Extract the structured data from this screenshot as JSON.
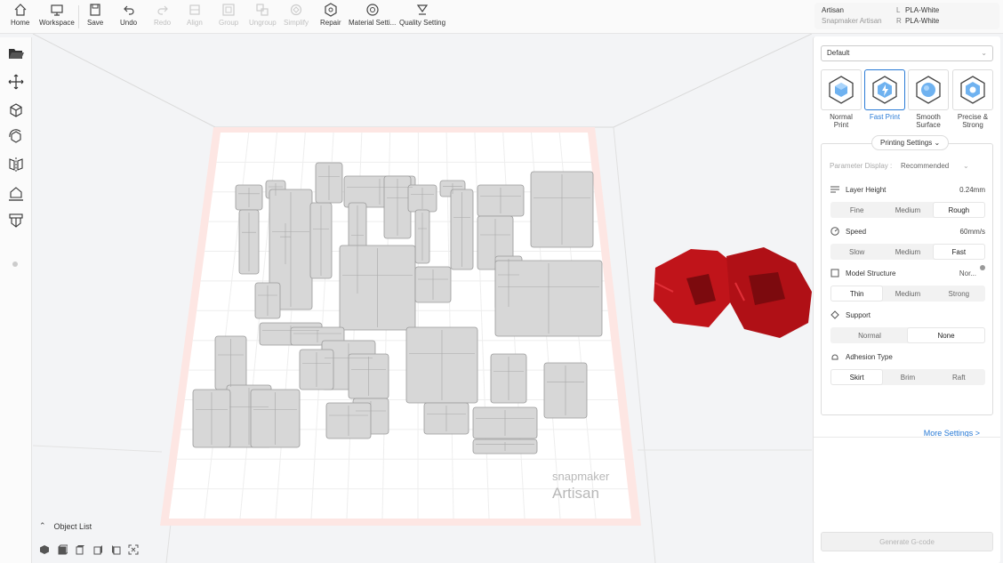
{
  "toolbar": {
    "home": "Home",
    "workspace": "Workspace",
    "save": "Save",
    "undo": "Undo",
    "redo": "Redo",
    "align": "Align",
    "group": "Group",
    "ungroup": "Ungroup",
    "simplify": "Simplify",
    "repair": "Repair",
    "material_settings": "Material Setti...",
    "quality_setting": "Quality Setting"
  },
  "machine": {
    "name": "Artisan",
    "module": "Snapmaker Artisan",
    "left_extruder": "L",
    "right_extruder": "R",
    "left_material": "PLA-White",
    "right_material": "PLA-White"
  },
  "left_sidebar": {
    "icons": [
      "folder-open-icon",
      "move-icon",
      "scale-icon",
      "rotate-icon",
      "mirror-icon",
      "place-on-face-icon",
      "support-icon"
    ]
  },
  "viewport": {
    "plate_brand": "snapmaker",
    "plate_model": "Artisan",
    "object_list_label": "Object List",
    "accent_red": "#c0141a"
  },
  "right_panel": {
    "preset_select": "Default",
    "presets": [
      {
        "label_line1": "Normal",
        "label_line2": "Print",
        "active": false
      },
      {
        "label_line1": "Fast Print",
        "label_line2": "",
        "active": true
      },
      {
        "label_line1": "Smooth",
        "label_line2": "Surface",
        "active": false
      },
      {
        "label_line1": "Precise &",
        "label_line2": "Strong",
        "active": false
      }
    ],
    "printing_settings_label": "Printing Settings",
    "parameter_display_label": "Parameter Display :",
    "parameter_display_value": "Recommended",
    "layer_height": {
      "label": "Layer Height",
      "value": "0.24mm",
      "options": [
        "Fine",
        "Medium",
        "Rough"
      ],
      "selected": "Rough"
    },
    "speed": {
      "label": "Speed",
      "value": "60mm/s",
      "options": [
        "Slow",
        "Medium",
        "Fast"
      ],
      "selected": "Fast"
    },
    "model_structure": {
      "label": "Model Structure",
      "value": "Nor...",
      "options": [
        "Thin",
        "Medium",
        "Strong"
      ],
      "selected": "Thin"
    },
    "support": {
      "label": "Support",
      "options": [
        "Normal",
        "None"
      ],
      "selected": "None"
    },
    "adhesion": {
      "label": "Adhesion Type",
      "options": [
        "Skirt",
        "Brim",
        "Raft"
      ],
      "selected": "Skirt"
    },
    "more_settings": "More Settings >",
    "generate_gcode": "Generate G-code"
  }
}
